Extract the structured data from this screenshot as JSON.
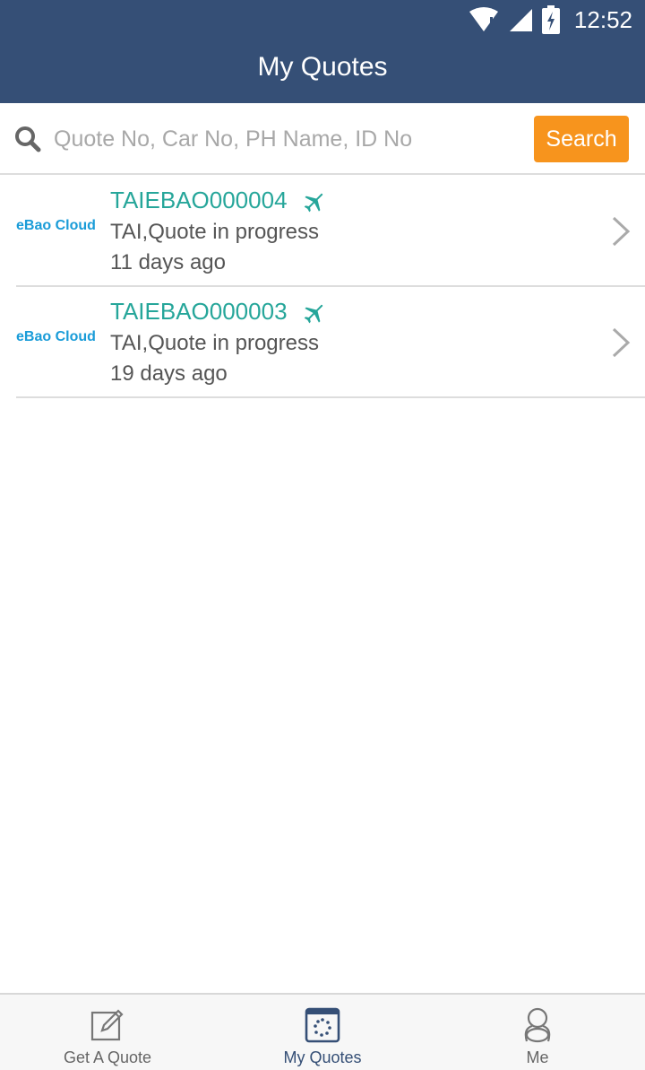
{
  "status_bar": {
    "time": "12:52",
    "wifi_icon": "wifi-alert-icon",
    "signal_icon": "cell-signal-icon",
    "battery_icon": "battery-charging-icon"
  },
  "header": {
    "title": "My Quotes"
  },
  "search": {
    "icon": "search-icon",
    "placeholder": "Quote No, Car No, PH Name, ID No",
    "value": "",
    "button_label": "Search"
  },
  "quotes": [
    {
      "logo_text": "eBao Cloud",
      "quote_no": "TAIEBAO000004",
      "status_icon": "airplane-icon",
      "status": "TAI,Quote in progress",
      "time_ago": "11 days ago"
    },
    {
      "logo_text": "eBao Cloud",
      "quote_no": "TAIEBAO000003",
      "status_icon": "airplane-icon",
      "status": "TAI,Quote in progress",
      "time_ago": "19 days ago"
    }
  ],
  "tabbar": {
    "tabs": [
      {
        "label": "Get A Quote",
        "icon": "edit-icon",
        "active": false
      },
      {
        "label": "My Quotes",
        "icon": "quotes-list-icon",
        "active": true
      },
      {
        "label": "Me",
        "icon": "person-icon",
        "active": false
      }
    ]
  },
  "colors": {
    "header_bg": "#354f76",
    "accent": "#f7941d",
    "quote_no": "#26a69a",
    "logo": "#1a9cd8"
  }
}
